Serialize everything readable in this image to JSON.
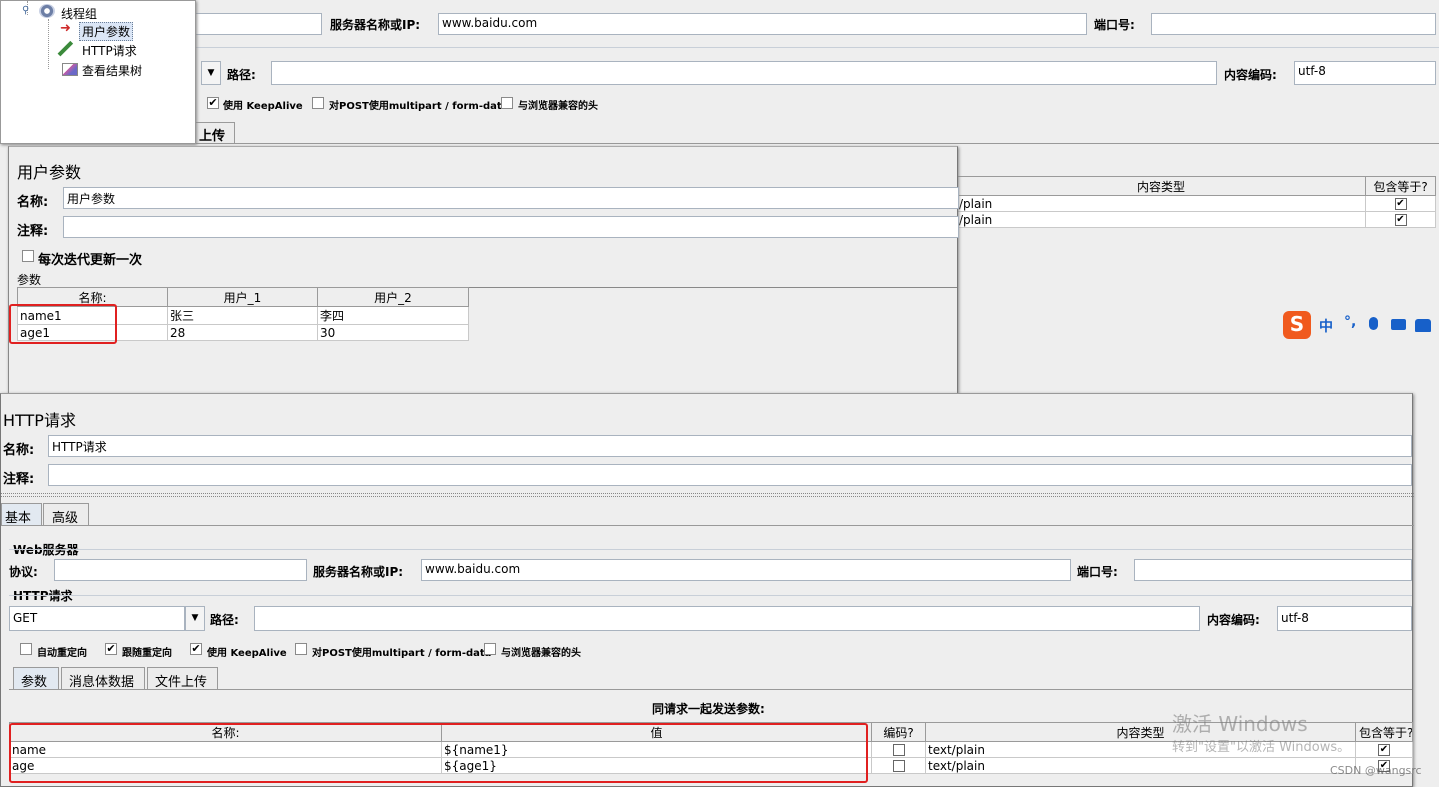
{
  "tree": {
    "thread_group": "线程组",
    "user_params": "用户参数",
    "http_request": "HTTP请求",
    "result_tree": "查看结果树"
  },
  "back": {
    "server_label": "服务器名称或IP:",
    "server_value": "www.baidu.com",
    "port_label": "端口号:",
    "path_label": "路径:",
    "encoding_label": "内容编码:",
    "encoding_value": "utf-8",
    "keepalive": "使用 KeepAlive",
    "multipart": "对POST使用multipart / form-data",
    "browser_headers": "与浏览器兼容的头",
    "upload_tab_fragment": "上传",
    "col_content_type": "内容类型",
    "col_include_equals": "包含等于?",
    "rows": [
      "/plain",
      "/plain"
    ]
  },
  "user_params": {
    "title": "用户参数",
    "name_label": "名称:",
    "name_value": "用户参数",
    "comment_label": "注释:",
    "update_each": "每次迭代更新一次",
    "params_label": "参数",
    "columns": [
      "名称:",
      "用户_1",
      "用户_2"
    ],
    "rows": [
      [
        "name1",
        "张三",
        "李四"
      ],
      [
        "age1",
        "28",
        "30"
      ]
    ]
  },
  "ime": {
    "zh": "中"
  },
  "http": {
    "title": "HTTP请求",
    "name_label": "名称:",
    "name_value": "HTTP请求",
    "comment_label": "注释:",
    "tabs": [
      "基本",
      "高级"
    ],
    "web_server": "Web服务器",
    "protocol_label": "协议:",
    "server_label": "服务器名称或IP:",
    "server_value": "www.baidu.com",
    "port_label": "端口号:",
    "http_request_section": "HTTP请求",
    "method": "GET",
    "path_label": "路径:",
    "encoding_label": "内容编码:",
    "encoding_value": "utf-8",
    "redirect_auto": "自动重定向",
    "follow_redirect": "跟随重定向",
    "keepalive": "使用 KeepAlive",
    "multipart": "对POST使用multipart / form-data",
    "browser_headers": "与浏览器兼容的头",
    "sub_tabs": [
      "参数",
      "消息体数据",
      "文件上传"
    ],
    "send_params_title": "同请求一起发送参数:",
    "columns": [
      "名称:",
      "值",
      "编码?",
      "内容类型",
      "包含等于?"
    ],
    "rows": [
      {
        "name": "name",
        "value": "${name1}",
        "content_type": "text/plain"
      },
      {
        "name": "age",
        "value": "${age1}",
        "content_type": "text/plain"
      }
    ]
  },
  "watermark": {
    "line1": "激活 Windows",
    "line2": "转到\"设置\"以激活 Windows。",
    "csdn": "CSDN @wangsrc"
  }
}
